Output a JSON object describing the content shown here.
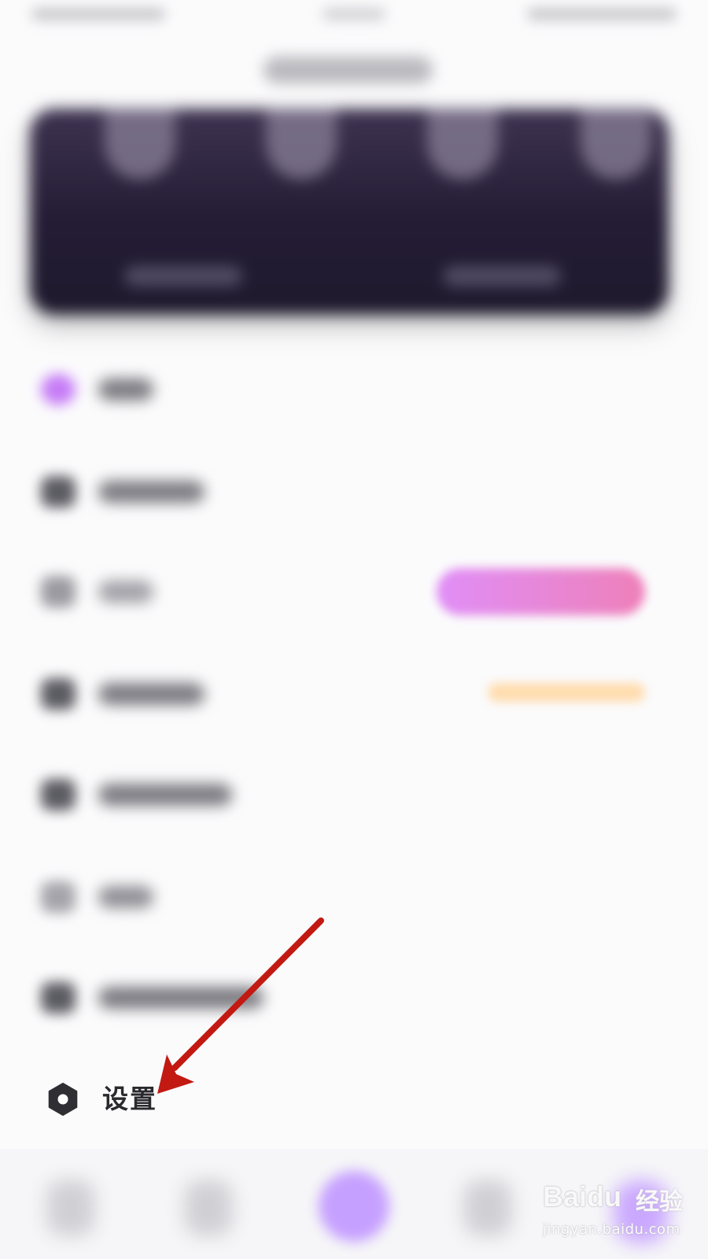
{
  "settings": {
    "label": "设置"
  },
  "watermark": {
    "brand": "Baidu",
    "brand_cn": "经验",
    "url": "jingyan.baidu.com"
  },
  "colors": {
    "arrow": "#c21a12",
    "settings_icon": "#2f2f33",
    "banner": "#241c35",
    "badge_purple": "#e08ef7",
    "badge_orange": "#ffd9a8"
  }
}
